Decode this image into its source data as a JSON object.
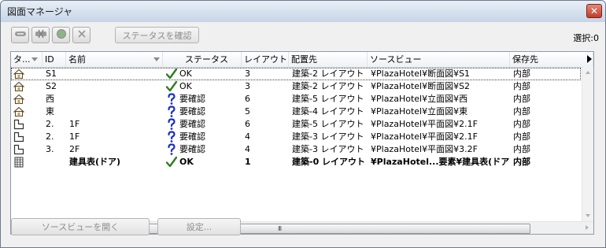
{
  "window": {
    "title": "図面マネージャ",
    "close_label": "✕"
  },
  "toolbar": {
    "confirm_status_label": "ステータスを確認",
    "selection_label": "選択:0"
  },
  "columns": {
    "type": "タ...",
    "id": "ID",
    "name": "名前",
    "status": "ステータス",
    "layout": "レイアウト...",
    "placement": "配置先",
    "source_view": "ソースビュー",
    "storage": "保存先"
  },
  "rows": [
    {
      "icon": "house-icon",
      "id": "S1",
      "name": "",
      "status_icon": "check",
      "status": "OK",
      "layout": "3",
      "placement": "建築-2 レイアウト",
      "source_view": "¥PlazaHotel¥断面図¥S1",
      "storage": "内部",
      "selected": true,
      "bold": false
    },
    {
      "icon": "house-icon",
      "id": "S2",
      "name": "",
      "status_icon": "check",
      "status": "OK",
      "layout": "3",
      "placement": "建築-2 レイアウト",
      "source_view": "¥PlazaHotel¥断面図¥S2",
      "storage": "内部",
      "selected": false,
      "bold": false
    },
    {
      "icon": "house-icon",
      "id": "西",
      "name": "",
      "status_icon": "question",
      "status": "要確認",
      "layout": "6",
      "placement": "建築-5 レイアウト",
      "source_view": "¥PlazaHotel¥立面図¥西",
      "storage": "内部",
      "selected": false,
      "bold": false
    },
    {
      "icon": "house-icon",
      "id": "東",
      "name": "",
      "status_icon": "question",
      "status": "要確認",
      "layout": "5",
      "placement": "建築-4 レイアウト",
      "source_view": "¥PlazaHotel¥立面図¥東",
      "storage": "内部",
      "selected": false,
      "bold": false
    },
    {
      "icon": "floorplan-icon",
      "id": "2.",
      "name": "1F",
      "status_icon": "question",
      "status": "要確認",
      "layout": "6",
      "placement": "建築-5 レイアウト",
      "source_view": "¥PlazaHotel¥平面図¥2.1F",
      "storage": "内部",
      "selected": false,
      "bold": false
    },
    {
      "icon": "floorplan-icon",
      "id": "2.",
      "name": "1F",
      "status_icon": "question",
      "status": "要確認",
      "layout": "4",
      "placement": "建築-3 レイアウト",
      "source_view": "¥PlazaHotel¥平面図¥2.1F",
      "storage": "内部",
      "selected": false,
      "bold": false
    },
    {
      "icon": "floorplan-icon",
      "id": "3.",
      "name": "2F",
      "status_icon": "question",
      "status": "要確認",
      "layout": "4",
      "placement": "建築-3 レイアウト",
      "source_view": "¥PlazaHotel¥平面図¥3.2F",
      "storage": "内部",
      "selected": false,
      "bold": false
    },
    {
      "icon": "schedule-icon",
      "id": "",
      "name": "建具表(ドア)",
      "status_icon": "check",
      "status": "OK",
      "layout": "1",
      "placement": "建築-0 レイアウト",
      "source_view": "¥PlazaHotel...要素¥建具表(ドア)",
      "storage": "内部",
      "selected": false,
      "bold": true
    }
  ],
  "scroll": {
    "grip": "III"
  },
  "footer": {
    "open_source_view_label": "ソースビューを開く",
    "settings_label": "設定..."
  },
  "colors": {
    "check": "#2e7d1f",
    "question": "#1a2fc9"
  }
}
